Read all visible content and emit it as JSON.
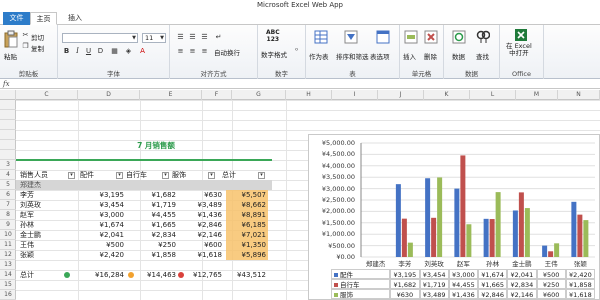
{
  "app": {
    "title": "Microsoft Excel Web App"
  },
  "tabs": [
    {
      "label": "文件"
    },
    {
      "label": "主页"
    },
    {
      "label": "插入"
    }
  ],
  "ribbon": {
    "clipboard": {
      "paste": "粘贴",
      "cut": "剪切",
      "copy": "复制",
      "label": "剪贴板"
    },
    "font": {
      "name": "",
      "size": "11",
      "label": "字体"
    },
    "alignment": {
      "wrap": "自动换行",
      "label": "对齐方式"
    },
    "number": {
      "format": "数字格式",
      "icon_text": "ABC\n123",
      "label": "数字"
    },
    "table": {
      "as_table": "作为表",
      "sort_filter": "排序和筛选",
      "table_options": "表选项",
      "label": "表"
    },
    "cells": {
      "insert": "插入",
      "delete": "删除",
      "label": "单元格"
    },
    "data": {
      "data": "数据",
      "find": "查找",
      "label": "数据"
    },
    "office": {
      "open_excel": "在 Excel\n中打开",
      "label": "Office"
    }
  },
  "formula_bar": {
    "fx": "fx",
    "value": ""
  },
  "columns": [
    "C",
    "D",
    "E",
    "F",
    "G",
    "H",
    "I",
    "J",
    "K",
    "L",
    "M",
    "N"
  ],
  "rows": [
    "",
    "",
    "",
    "",
    "",
    "",
    "3",
    "4",
    "5",
    "6",
    "7",
    "8",
    "9",
    "10",
    "11",
    "12",
    "13",
    "14",
    "15",
    "16",
    "17"
  ],
  "pivot": {
    "title": "7 月销售额",
    "headers": [
      "销售人员",
      "配件",
      "自行车",
      "服饰",
      "总计"
    ],
    "group_row": "郑建杰",
    "rows": [
      {
        "name": "李芳",
        "accessories": "¥3,195",
        "bikes": "¥1,682",
        "clothing": "¥630",
        "total": "¥5,507"
      },
      {
        "name": "刘英玫",
        "accessories": "¥3,454",
        "bikes": "¥1,719",
        "clothing": "¥3,489",
        "total": "¥8,662"
      },
      {
        "name": "赵军",
        "accessories": "¥3,000",
        "bikes": "¥4,455",
        "clothing": "¥1,436",
        "total": "¥8,891"
      },
      {
        "name": "孙林",
        "accessories": "¥1,674",
        "bikes": "¥1,665",
        "clothing": "¥2,846",
        "total": "¥6,185"
      },
      {
        "name": "金士鹏",
        "accessories": "¥2,041",
        "bikes": "¥2,834",
        "clothing": "¥2,146",
        "total": "¥7,021"
      },
      {
        "name": "王伟",
        "accessories": "¥500",
        "bikes": "¥250",
        "clothing": "¥600",
        "total": "¥1,350"
      },
      {
        "name": "张颖",
        "accessories": "¥2,420",
        "bikes": "¥1,858",
        "clothing": "¥1,618",
        "total": "¥5,896"
      }
    ],
    "total": {
      "name": "总计",
      "accessories": "¥16,284",
      "bikes": "¥14,463",
      "clothing": "¥12,765",
      "total": "¥43,512"
    }
  },
  "colors": {
    "accessories": "#4472c4",
    "bikes": "#c0504d",
    "clothing": "#9bbb59",
    "title_green": "#2a9a4a",
    "highlight": "#f7c26b"
  },
  "chart_data": {
    "type": "bar",
    "title": "",
    "xlabel": "",
    "ylabel": "",
    "ylim": [
      0,
      5000
    ],
    "yticks": [
      "¥5,000.00",
      "¥4,500.00",
      "¥4,000.00",
      "¥3,500.00",
      "¥3,000.00",
      "¥2,500.00",
      "¥2,000.00",
      "¥1,500.00",
      "¥1,000.00",
      "¥500.00",
      "¥0.00"
    ],
    "categories": [
      "郑建杰",
      "李芳",
      "刘英玫",
      "赵军",
      "孙林",
      "金士鹏",
      "王伟",
      "张颖"
    ],
    "series": [
      {
        "name": "配件",
        "values": [
          0,
          3195,
          3454,
          3000,
          1674,
          2041,
          500,
          2420
        ]
      },
      {
        "name": "自行车",
        "values": [
          0,
          1682,
          1719,
          4455,
          1665,
          2834,
          250,
          1858
        ]
      },
      {
        "name": "服饰",
        "values": [
          0,
          630,
          3489,
          1436,
          2846,
          2146,
          600,
          1618
        ]
      }
    ],
    "table": [
      [
        "¥3,195",
        "¥3,454",
        "¥3,000",
        "¥1,674",
        "¥2,041",
        "¥500",
        "¥2,420"
      ],
      [
        "¥1,682",
        "¥1,719",
        "¥4,455",
        "¥1,665",
        "¥2,834",
        "¥250",
        "¥1,858"
      ],
      [
        "¥630",
        "¥3,489",
        "¥1,436",
        "¥2,846",
        "¥2,146",
        "¥600",
        "¥1,618"
      ]
    ],
    "legend": "bottom-table"
  }
}
